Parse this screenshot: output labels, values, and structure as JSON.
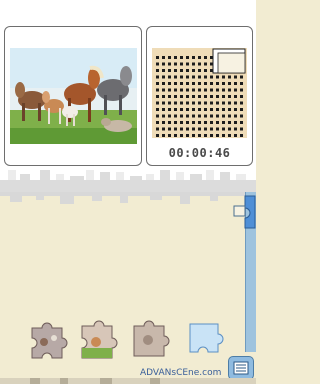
{
  "top": {
    "preview_alt": "Horses and foals on grass",
    "timer": "00:00:46"
  },
  "bottom": {
    "watermark": "ADVANsCEne.com"
  },
  "colors": {
    "board": "#f2ecd2",
    "minimap_bg": "#efdcb8",
    "accent_blue": "#8fbbe0"
  },
  "icons": {
    "menu": "list-icon",
    "scroll": "puzzle-piece-icon"
  }
}
